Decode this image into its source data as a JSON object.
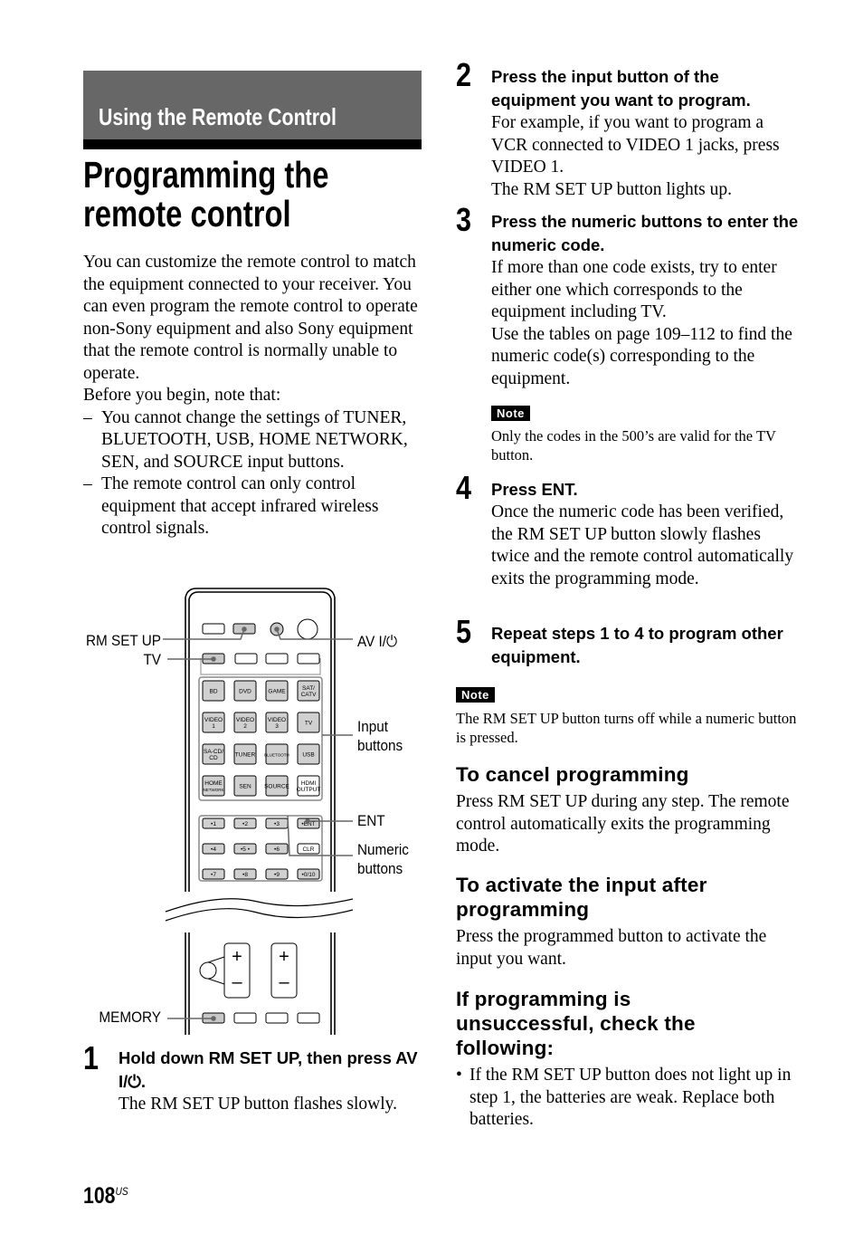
{
  "section": {
    "title": "Using the Remote Control"
  },
  "page_title_lines": [
    "Programming the",
    "remote control"
  ],
  "intro": {
    "paragraph": "You can customize the remote control to match the equipment connected to your receiver. You can even program the remote control to operate non-Sony equipment and also Sony equipment that the remote control is normally unable to operate.",
    "lead": "Before you begin, note that:",
    "items": [
      "You cannot change the settings of TUNER, BLUETOOTH, USB, HOME NETWORK, SEN, and SOURCE input buttons.",
      "The remote control can only control equipment that accept infrared wireless control signals."
    ]
  },
  "figure": {
    "callouts": {
      "rm_set_up": "RM SET UP",
      "tv": "TV",
      "av_power": "AV I/⏻",
      "input_buttons_1": "Input",
      "input_buttons_2": "buttons",
      "ent": "ENT",
      "numeric_1": "Numeric",
      "numeric_2": "buttons",
      "memory": "MEMORY"
    },
    "input_buttons": [
      [
        "BD",
        "DVD",
        "GAME",
        "SAT/\nCATV"
      ],
      [
        "VIDEO\n1",
        "VIDEO\n2",
        "VIDEO\n3",
        "TV"
      ],
      [
        "SA-CD/\nCD",
        "TUNER",
        "BLUETOOTH",
        "USB"
      ],
      [
        "HOME\nNETWORK",
        "SEN",
        "SOURCE",
        "HDMI\nOUTPUT"
      ]
    ],
    "numeric_buttons": [
      [
        "•1",
        "•2",
        "•3",
        "•ENT"
      ],
      [
        "•4",
        "•5 •",
        "•6",
        "CLR"
      ],
      [
        "•7",
        "•8",
        "•9",
        "•0/10"
      ]
    ]
  },
  "steps": [
    {
      "num": "1",
      "head": "Hold down RM SET UP, then press AV I/⏻.",
      "body": "The RM SET UP button flashes slowly."
    },
    {
      "num": "2",
      "head": "Press the input button of the equipment you want to program.",
      "body": "For example, if you want to program a VCR connected to VIDEO 1 jacks, press VIDEO 1.",
      "body2": "The RM SET UP button lights up."
    },
    {
      "num": "3",
      "head": "Press the numeric buttons to enter the numeric code.",
      "body": "If more than one code exists, try to enter either one which corresponds to the equipment including TV.",
      "body2": "Use the tables on page 109–112 to find the numeric code(s) corresponding to the equipment.",
      "note_label": "Note",
      "note": "Only the codes in the 500’s are valid for the TV button."
    },
    {
      "num": "4",
      "head": "Press ENT.",
      "body": "Once the numeric code has been verified, the RM SET UP button slowly flashes twice and the remote control automatically exits the programming mode."
    },
    {
      "num": "5",
      "head": "Repeat steps 1 to 4 to program other equipment."
    }
  ],
  "note": {
    "label": "Note",
    "text": "The RM SET UP button turns off while a numeric button is pressed."
  },
  "cancel": {
    "heading": "To cancel programming",
    "text": "Press RM SET UP during any step. The remote control automatically exits the programming mode."
  },
  "activate": {
    "heading": "To activate the input after programming",
    "text": "Press the programmed button to activate the input you want."
  },
  "unsuccessful": {
    "heading": "If programming is unsuccessful, check the following:",
    "bullets": [
      "If the RM SET UP button does not light up in step 1, the batteries are weak. Replace both batteries."
    ]
  },
  "footer": {
    "page": "108",
    "suffix": "US"
  }
}
